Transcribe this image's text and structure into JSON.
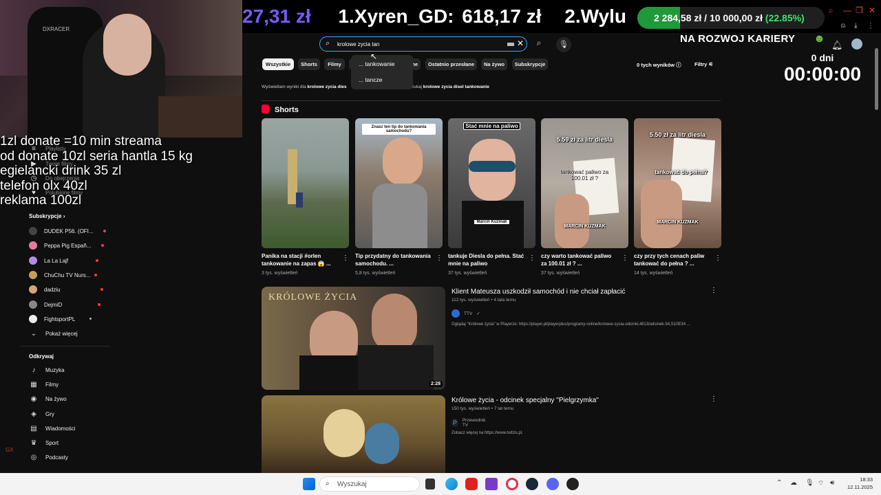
{
  "overlay": {
    "donate_lines": [
      "1zl donate =10 min streama",
      "od donate 10zl seria hantla 15 kg",
      "egielancki drink 35 zl",
      "telefon olx 40zl",
      "reklama 100zl"
    ],
    "ticker_amount_1": "27,31 zł",
    "ticker_name_2": "1.Xyren_GD:",
    "ticker_amount_2": "618,17 zł",
    "ticker_name_3": "2.Wylu",
    "goal_current": "2 284,58 zł",
    "goal_sep": "/",
    "goal_target": "10 000,00 zł",
    "goal_pct_label": "(22.85%)",
    "goal_fraction": 0.2285,
    "goal_caption": "NA ROZWOJ KARIERY",
    "timer_days": "0 dni",
    "timer_time": "00:00:00",
    "webcam_brand": "DXRACER"
  },
  "search": {
    "query": "krolowe zycia tan",
    "suggestions": [
      "... tankowanie",
      "... tancze"
    ]
  },
  "chips": [
    "Wszystkie",
    "Shorts",
    "Filmy",
    "Nieobejrzane",
    "Ostatnio przesłane",
    "Na żywo",
    "Subskrypcje"
  ],
  "chip_visible": [
    "Wszystkie",
    "Shorts",
    "Filmy",
    "ane",
    "Ostatnio przesłane",
    "Na żywo",
    "Subskrypcje"
  ],
  "results_count": "0 tych wyników",
  "filters_label": "Filtry",
  "notice": {
    "prefix": "Wyświetlam wyniki dla",
    "bold1": "krolowe zycia dies",
    "mid": "o wyszukaj",
    "bold2": "krolowe zycia disel tankowanie"
  },
  "sidebar": {
    "top_items": [
      "Playlisty",
      "Twoje filmy",
      "Do obejrzenia",
      "Polubione filmy"
    ],
    "subs_header": "Subskrypcje",
    "subs": [
      {
        "name": "DUDEK P56. (OFI...",
        "color": "#444"
      },
      {
        "name": "Peppa Pig Españ...",
        "color": "#e87aa0"
      },
      {
        "name": "La La Lajf",
        "color": "#b48be6"
      },
      {
        "name": "ChuChu TV Nurs...",
        "color": "#c5a05a"
      },
      {
        "name": "dadziu",
        "color": "#d6a57a"
      },
      {
        "name": "DejmiD",
        "color": "#888"
      },
      {
        "name": "FightsportPL",
        "color": "#eee"
      }
    ],
    "show_more": "Pokaż więcej",
    "explore_header": "Odkrywaj",
    "explore": [
      {
        "icon": "♪",
        "label": "Muzyka"
      },
      {
        "icon": "▦",
        "label": "Filmy"
      },
      {
        "icon": "◉",
        "label": "Na żywo"
      },
      {
        "icon": "◈",
        "label": "Gry"
      },
      {
        "icon": "▤",
        "label": "Wiadomości"
      },
      {
        "icon": "♛",
        "label": "Sport"
      },
      {
        "icon": "◎",
        "label": "Podcasty"
      }
    ]
  },
  "shorts": {
    "header": "Shorts",
    "items": [
      {
        "title": "Panika na stacji #orlen tankowanie na zapas 😱 ...",
        "views": "3 tys. wyświetleń",
        "overlay": "",
        "bg": "#4d5a52"
      },
      {
        "title": "Tip przydatny do tankowania samochodu. ...",
        "views": "5,8 tys. wyświetleń",
        "overlay": "Znasz ten tip do tankowania samochodu?",
        "bg": "#7d6a5a"
      },
      {
        "title": "tankuje Diesla do pełna. Stać mnie na paliwo",
        "views": "37 tys. wyświetleń",
        "overlay": "Stać mnie na paliwo",
        "bg": "#3a3a3a"
      },
      {
        "title": "czy warto tankować paliwo za 100.01 zł ? ...",
        "views": "37 tys. wyświetleń",
        "overlay": "5.59 zł za litr diesla",
        "bg": "#8a8580"
      },
      {
        "title": "czy przy tych cenach paliw tankować do pełna ? ...",
        "views": "14 tys. wyświetleń",
        "overlay": "5.50 zł za litr diesla",
        "bg": "#9a7d6e"
      }
    ],
    "short3_caption": "Marcin Kuźmak",
    "short4_caption1": "tankować paliwo za 100.01 zł ?",
    "short4_caption2": "MARCIN KUZMAK",
    "short5_caption1": "tankować do pełna?",
    "short5_caption2": "MARCIN KUZMAK"
  },
  "videos": [
    {
      "title": "Klient Mateusza uszkodził samochód i nie chciał zapłacić",
      "meta": "112 tys. wyświetleń • 4 lata temu",
      "channel": "TTV",
      "desc": "Oglądaj \"Królowe życia\" w Playerze: https://player.pl/playerplus/programy-online/krolowe-zycia-odcinki,4813/odcinek-34,S10E34 ...",
      "duration": "2:28",
      "thumb_text": "KRÓLOWE ŻYCIA"
    },
    {
      "title": "Królowe życia - odcinek specjalny \"Pielgrzymka\"",
      "meta": "150 tys. wyświetleń • 7 lat temu",
      "channel": "Przewodnik TV",
      "desc": "Zobacz więcej na https://www.tvdzis.pl.",
      "duration": "",
      "thumb_text": ""
    }
  ],
  "taskbar": {
    "search_placeholder": "Wyszukaj",
    "time": "18:33",
    "date": "12.11.2025"
  },
  "colors": {
    "accent_blue": "#3ea6ff",
    "banner_purple": "#7a5af8",
    "goal_green": "#1e9a3a",
    "youtube_red": "#ff0033"
  }
}
